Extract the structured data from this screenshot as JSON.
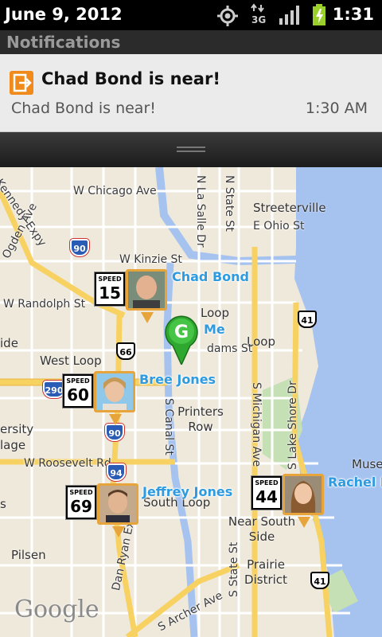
{
  "status_bar": {
    "date": "June 9, 2012",
    "time": "1:31",
    "network": "3G",
    "icons": [
      "gps-icon",
      "network-3g-icon",
      "signal-icon",
      "battery-charging-icon"
    ]
  },
  "shade": {
    "title": "Notifications"
  },
  "notification": {
    "title": "Chad Bond is near!",
    "body": "Chad Bond is near!",
    "time": "1:30 AM",
    "icon": "exit-door-icon",
    "icon_color": "#f08a1b"
  },
  "map": {
    "streets": [
      "W Chicago Ave",
      "Kennedy Expy",
      "N La Salle Dr",
      "N State St",
      "Streeterville",
      "E Ohio St",
      "W Kinzie St",
      "W Randolph St",
      "Loop",
      "West Loop",
      "Printers Row",
      "S Canal St",
      "S Michigan Ave",
      "S Lake Shore Dr",
      "W Roosevelt Rd",
      "South Loop",
      "Near South Side",
      "Prairie District",
      "Pilsen",
      "Dan Ryan Expy",
      "S Archer Ave",
      "S State St",
      "Museum",
      "ersity",
      "lage",
      "Ogden Ave",
      "dams St",
      "ide",
      "s"
    ],
    "shields": [
      "90",
      "41",
      "66",
      "290",
      "90",
      "94",
      "41"
    ],
    "attribution": "Google"
  },
  "users": [
    {
      "name": "Chad Bond",
      "speed_caption": "SPEED",
      "speed": "15"
    },
    {
      "name": "Me"
    },
    {
      "name": "Bree Jones",
      "speed_caption": "SPEED",
      "speed": "60"
    },
    {
      "name": "Jeffrey Jones",
      "speed_caption": "SPEED",
      "speed": "69"
    },
    {
      "name": "Rachel B",
      "speed_caption": "SPEED",
      "speed": "44"
    }
  ],
  "colors": {
    "accent_name": "#2e9be0",
    "avatar_frame": "#e7a43a",
    "map_water": "#a6c3f0",
    "map_land": "#efe9dc",
    "highway": "#f7d263",
    "me_marker": "#2fa82f"
  }
}
